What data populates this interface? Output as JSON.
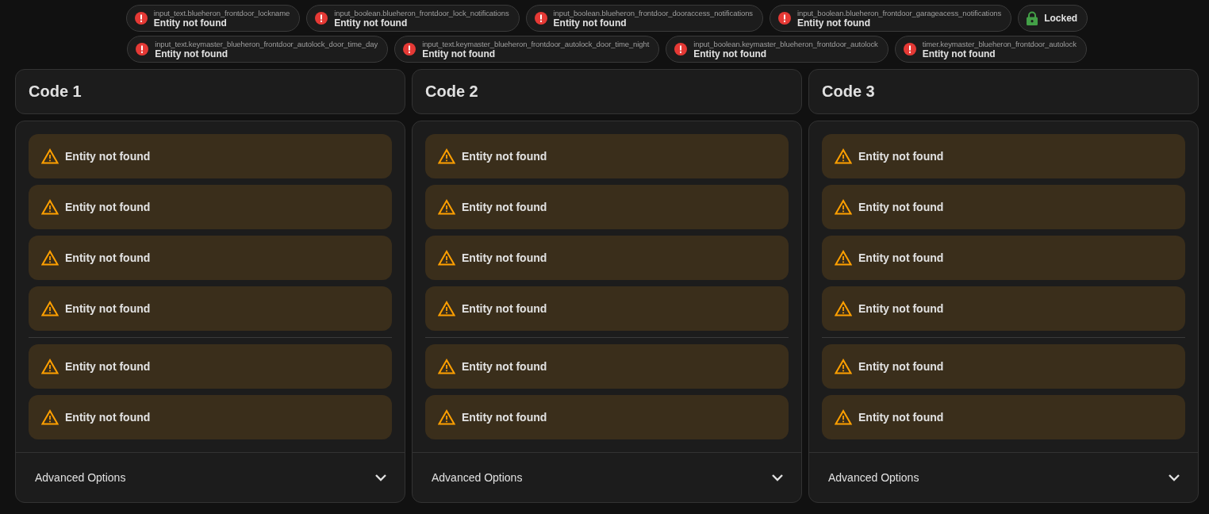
{
  "chip_rows": [
    [
      {
        "kind": "error",
        "entity": "input_text.blueheron_frontdoor_lockname",
        "status": "Entity not found"
      },
      {
        "kind": "error",
        "entity": "input_boolean.blueheron_frontdoor_lock_notifications",
        "status": "Entity not found"
      },
      {
        "kind": "error",
        "entity": "input_boolean.blueheron_frontdoor_dooraccess_notifications",
        "status": "Entity not found"
      },
      {
        "kind": "error",
        "entity": "input_boolean.blueheron_frontdoor_garageacess_notifications",
        "status": "Entity not found"
      },
      {
        "kind": "lock",
        "status": "Locked"
      }
    ],
    [
      {
        "kind": "error",
        "entity": "input_text.keymaster_blueheron_frontdoor_autolock_door_time_day",
        "status": "Entity not found"
      },
      {
        "kind": "error",
        "entity": "input_text.keymaster_blueheron_frontdoor_autolock_door_time_night",
        "status": "Entity not found"
      },
      {
        "kind": "error",
        "entity": "input_boolean.keymaster_blueheron_frontdoor_autolock",
        "status": "Entity not found"
      },
      {
        "kind": "error",
        "entity": "timer.keymaster_blueheron_frontdoor_autolock",
        "status": "Entity not found"
      }
    ]
  ],
  "codes": [
    {
      "title": "Code 1",
      "groups": [
        [
          "Entity not found",
          "Entity not found",
          "Entity not found",
          "Entity not found"
        ],
        [
          "Entity not found",
          "Entity not found"
        ]
      ],
      "advanced": {
        "label": "Advanced Options",
        "expanded": false
      }
    },
    {
      "title": "Code 2",
      "groups": [
        [
          "Entity not found",
          "Entity not found",
          "Entity not found",
          "Entity not found"
        ],
        [
          "Entity not found",
          "Entity not found"
        ]
      ],
      "advanced": {
        "label": "Advanced Options",
        "expanded": false
      }
    },
    {
      "title": "Code 3",
      "groups": [
        [
          "Entity not found",
          "Entity not found",
          "Entity not found",
          "Entity not found"
        ],
        [
          "Entity not found",
          "Entity not found"
        ]
      ],
      "advanced": {
        "label": "Advanced Options",
        "expanded": false
      }
    }
  ]
}
